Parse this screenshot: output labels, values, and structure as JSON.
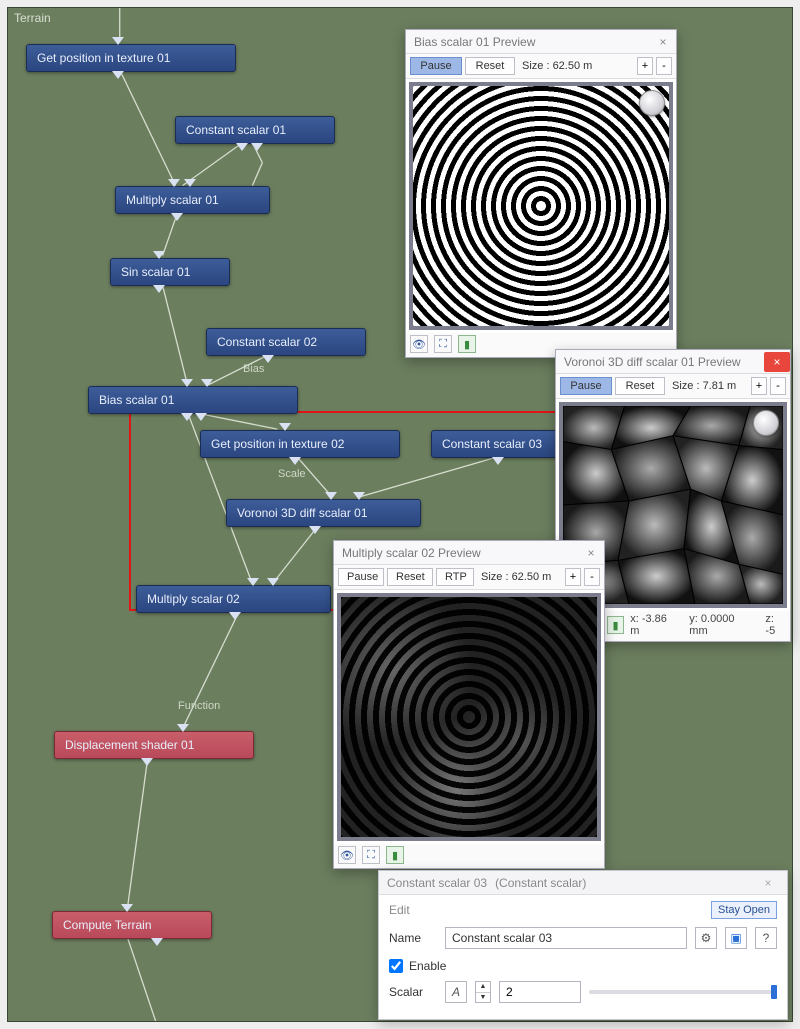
{
  "panel": {
    "title": "Terrain"
  },
  "nodes": {
    "get_pos_1": "Get position in texture 01",
    "const_1": "Constant scalar 01",
    "mult_1": "Multiply scalar 01",
    "sin_1": "Sin scalar 01",
    "const_2": "Constant scalar 02",
    "bias_1": "Bias scalar 01",
    "get_pos_2": "Get position in texture 02",
    "const_3": "Constant scalar 03",
    "voronoi_1": "Voronoi 3D diff scalar 01",
    "mult_2": "Multiply scalar 02",
    "disp_1": "Displacement shader 01",
    "compute": "Compute Terrain"
  },
  "edge_labels": {
    "bias": "Bias",
    "scale": "Scale",
    "function": "Function"
  },
  "preview1": {
    "title": "Bias scalar 01 Preview",
    "pause": "Pause",
    "reset": "Reset",
    "size_label": "Size :  62.50 m",
    "plus": "+",
    "minus": "-"
  },
  "preview2": {
    "title": "Voronoi 3D diff scalar 01 Preview",
    "pause": "Pause",
    "reset": "Reset",
    "size_label": "Size :  7.81 m",
    "plus": "+",
    "minus": "-",
    "coord_x": "x: -3.86 m",
    "coord_y": "y: 0.0000 mm",
    "coord_z": "z: -5"
  },
  "preview3": {
    "title": "Multiply scalar 02 Preview",
    "pause": "Pause",
    "reset": "Reset",
    "rtp": "RTP",
    "size_label": "Size :  62.50 m",
    "plus": "+",
    "minus": "-"
  },
  "prop": {
    "title": "Constant scalar 03",
    "type": "(Constant scalar)",
    "edit": "Edit",
    "stay_open": "Stay Open",
    "name_label": "Name",
    "name_value": "Constant scalar 03",
    "enable_label": "Enable",
    "scalar_label": "Scalar",
    "scalar_value": "2",
    "help": "?"
  }
}
